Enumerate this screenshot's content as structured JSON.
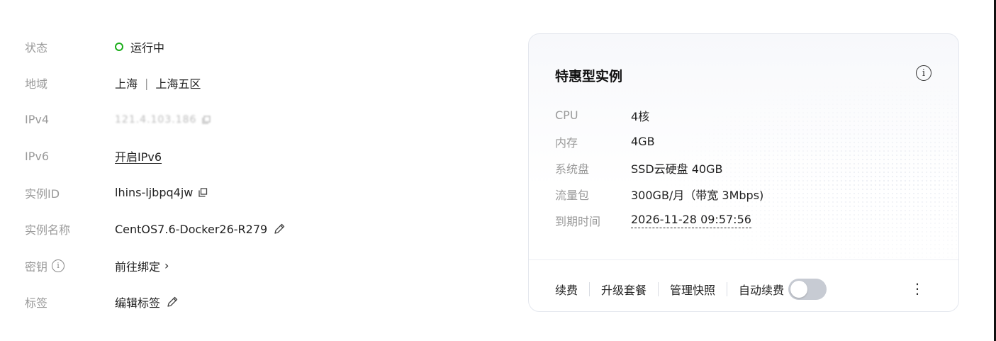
{
  "info": {
    "status": {
      "label": "状态",
      "value": "运行中",
      "color": "#1aad19"
    },
    "region": {
      "label": "地域",
      "city": "上海",
      "separator": "|",
      "zone": "上海五区"
    },
    "ipv4": {
      "label": "IPv4",
      "value": "121.4.103.186"
    },
    "ipv6": {
      "label": "IPv6",
      "value": "开启IPv6"
    },
    "instance_id": {
      "label": "实例ID",
      "value": "lhins-ljbpq4jw"
    },
    "instance_name": {
      "label": "实例名称",
      "value": "CentOS7.6-Docker26-R279"
    },
    "key": {
      "label": "密钥",
      "value": "前往绑定",
      "chevron": "›"
    },
    "tags": {
      "label": "标签",
      "value": "编辑标签"
    }
  },
  "card": {
    "title": "特惠型实例",
    "info_icon": "i",
    "specs": [
      {
        "label": "CPU",
        "value": "4核"
      },
      {
        "label": "内存",
        "value": "4GB"
      },
      {
        "label": "系统盘",
        "value": "SSD云硬盘 40GB"
      },
      {
        "label": "流量包",
        "value": "300GB/月（带宽 3Mbps)"
      },
      {
        "label": "到期时间",
        "value": "2026-11-28 09:57:56"
      }
    ],
    "actions": {
      "renew": "续费",
      "upgrade": "升级套餐",
      "snapshot": "管理快照",
      "auto_renew": "自动续费",
      "more": "⋮"
    },
    "auto_renew_enabled": false
  }
}
